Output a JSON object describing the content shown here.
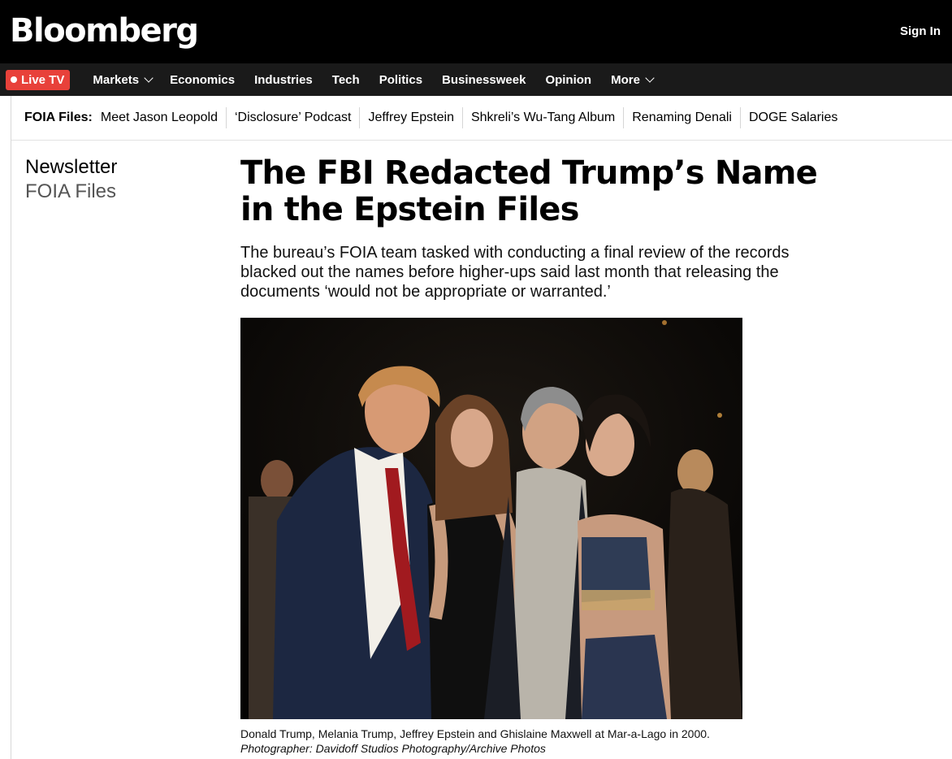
{
  "header": {
    "brand": "Bloomberg",
    "sign_in": "Sign In"
  },
  "nav": {
    "live_tv": "Live TV",
    "items": [
      {
        "label": "Markets",
        "dropdown": true
      },
      {
        "label": "Economics",
        "dropdown": false
      },
      {
        "label": "Industries",
        "dropdown": false
      },
      {
        "label": "Tech",
        "dropdown": false
      },
      {
        "label": "Politics",
        "dropdown": false
      },
      {
        "label": "Businessweek",
        "dropdown": false
      },
      {
        "label": "Opinion",
        "dropdown": false
      },
      {
        "label": "More",
        "dropdown": true
      }
    ]
  },
  "subnav": {
    "label": "FOIA Files:",
    "links": [
      "Meet Jason Leopold",
      "‘Disclosure’ Podcast",
      "Jeffrey Epstein",
      "Shkreli’s Wu-Tang Album",
      "Renaming Denali",
      "DOGE Salaries"
    ]
  },
  "newsletter": {
    "kicker": "Newsletter",
    "name": "FOIA Files"
  },
  "article": {
    "headline": "The FBI Redacted Trump’s Name in the Epstein Files",
    "dek": "The bureau’s FOIA team tasked with conducting a final review of the records blacked out the names before higher-ups said last month that releasing the documents ‘would not be appropriate or warranted.’",
    "caption": "Donald Trump, Melania Trump, Jeffrey Epstein and Ghislaine Maxwell at Mar-a-Lago in 2000.",
    "credit": "Photographer: Davidoff Studios Photography/Archive Photos"
  },
  "colors": {
    "live_tv": "#e8413a",
    "topbar": "#000000",
    "navbar": "#1a1a1a"
  },
  "icons": {
    "dropdown": "chevron-down-icon",
    "live": "live-dot-icon"
  }
}
